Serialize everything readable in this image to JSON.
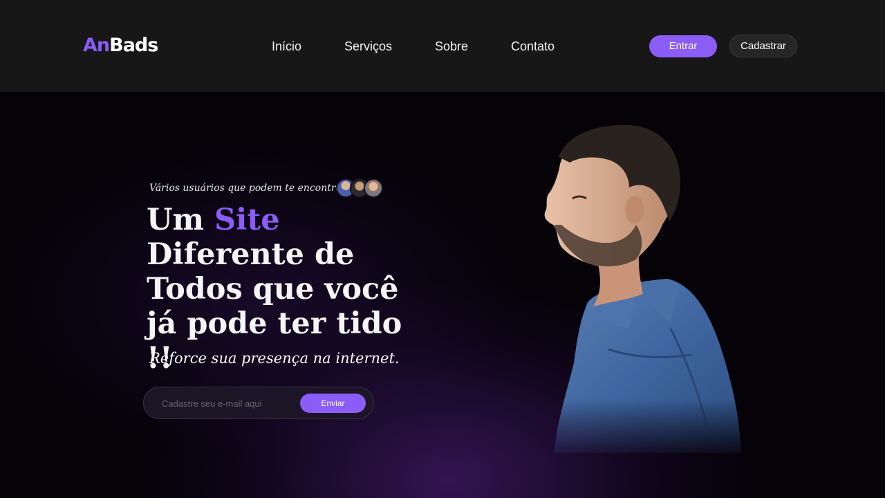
{
  "header": {
    "logo_accent": "An",
    "logo_rest": "Bads",
    "nav": [
      "Início",
      "Serviços",
      "Sobre",
      "Contato"
    ],
    "login_label": "Entrar",
    "signup_label": "Cadastrar"
  },
  "hero": {
    "users_text": "Vários usuários que podem te encontrar",
    "headline_part1": "Um ",
    "headline_accent": "Site",
    "headline_part2": " Diferente de Todos que você já pode ter tido !!",
    "subtitle": "Reforce sua presença na internet.",
    "email_placeholder": "Cadastre seu e-mail aqui",
    "send_label": "Enviar"
  },
  "colors": {
    "accent": "#8b5cf6",
    "header_bg": "#171717",
    "hero_bg": "#050208"
  },
  "icons": [
    "user-avatar-1",
    "user-avatar-2",
    "user-avatar-3"
  ]
}
